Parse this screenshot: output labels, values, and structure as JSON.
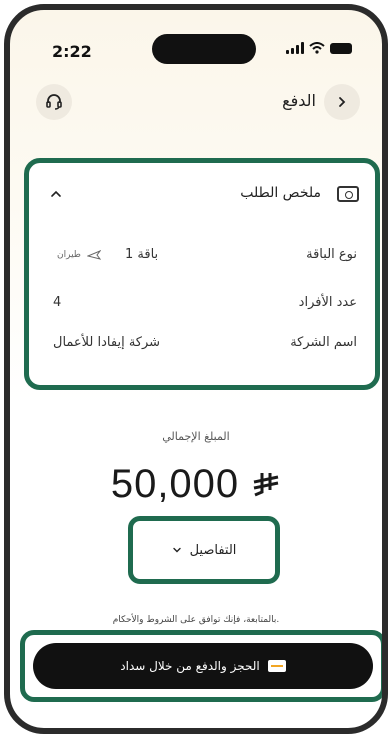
{
  "status_bar": {
    "time": "2:22"
  },
  "header": {
    "title": "الدفع",
    "back_icon": "chevron-right-icon",
    "support_icon": "headset-icon"
  },
  "summary": {
    "title": "ملخص الطلب",
    "rows": [
      {
        "label": "نوع الباقة",
        "value": "باقة 1",
        "tag": "طيران"
      },
      {
        "label": "عدد الأفراد",
        "value": "4"
      },
      {
        "label": "اسم الشركة",
        "value": "شركة إيفادا للأعمال"
      }
    ]
  },
  "total": {
    "label": "المبلغ الإجمالي",
    "amount": "50,000",
    "currency_icon": "riyal-symbol-icon"
  },
  "details": {
    "label": "التفاصيل"
  },
  "terms": {
    "text": "بالمتابعة، فإنك توافق على الشروط والأحكام."
  },
  "cta": {
    "label": "الحجز والدفع من خلال سداد",
    "icon": "sadad-icon"
  },
  "colors": {
    "highlight": "#1f6b4f",
    "cta_bg": "#111111",
    "sadad_accent": "#f2a623"
  }
}
